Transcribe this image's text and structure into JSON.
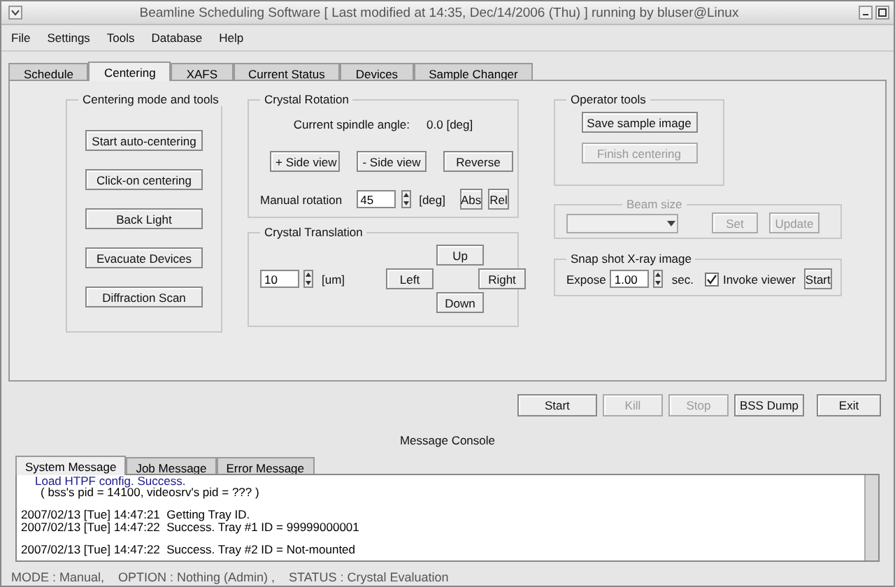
{
  "window": {
    "title": "Beamline Scheduling Software [ Last modified at 14:35, Dec/14/2006 (Thu) ] running by bluser@Linux"
  },
  "menu": [
    "File",
    "Settings",
    "Tools",
    "Database",
    "Help"
  ],
  "tabs": [
    {
      "label": "Schedule",
      "selected": false
    },
    {
      "label": "Centering",
      "selected": true
    },
    {
      "label": "XAFS",
      "selected": false
    },
    {
      "label": "Current Status",
      "selected": false
    },
    {
      "label": "Devices",
      "selected": false
    },
    {
      "label": "Sample Changer",
      "selected": false
    }
  ],
  "centering_tools": {
    "title": "Centering mode and tools",
    "buttons": [
      "Start auto-centering",
      "Click-on centering",
      "Back Light",
      "Evacuate Devices",
      "Diffraction Scan"
    ]
  },
  "crystal_rotation": {
    "title": "Crystal Rotation",
    "angle_label": "Current spindle angle:",
    "angle_value": "0.0 [deg]",
    "buttons": [
      "+ Side view",
      "- Side view",
      "Reverse"
    ],
    "manual_label": "Manual rotation",
    "manual_value": "45",
    "unit": "[deg]",
    "manual_buttons": [
      "Abs",
      "Rel"
    ]
  },
  "crystal_translation": {
    "title": "Crystal Translation",
    "step_value": "10",
    "unit": "[um]",
    "buttons": [
      {
        "label": "Up",
        "kind": "up"
      },
      {
        "label": "Left",
        "kind": "left"
      },
      {
        "label": "Right",
        "kind": "right"
      },
      {
        "label": "Down",
        "kind": "down"
      }
    ]
  },
  "operator_tools": {
    "title": "Operator tools",
    "buttons": [
      {
        "label": "Save sample image",
        "disabled": false
      },
      {
        "label": "Finish centering",
        "disabled": true
      }
    ]
  },
  "beam_size": {
    "title": "Beam size",
    "disabled": true,
    "buttons": [
      {
        "label": "Set",
        "disabled": true
      },
      {
        "label": "Update",
        "disabled": true
      }
    ]
  },
  "snapshot": {
    "title": "Snap shot X-ray image",
    "expose_label": "Expose",
    "expose_value": "1.00",
    "unit": "sec.",
    "invoke_viewer": {
      "label": "Invoke viewer",
      "checked": true
    },
    "button": "Start"
  },
  "actions": [
    {
      "label": "Start",
      "disabled": false
    },
    {
      "label": "Kill",
      "disabled": true
    },
    {
      "label": "Stop",
      "disabled": true
    },
    {
      "label": "BSS Dump",
      "disabled": false
    },
    {
      "label": "Exit",
      "disabled": false
    }
  ],
  "console": {
    "title": "Message Console",
    "tabs": [
      {
        "label": "System Message",
        "selected": true
      },
      {
        "label": "Job Message",
        "selected": false
      },
      {
        "label": "Error Message",
        "selected": false
      }
    ],
    "lines": [
      {
        "text": "Load HTPF config. Success.",
        "color": "#1a1a8c",
        "gap_before": false
      },
      {
        "text": "( bss's pid = 14100, videosrv's pid = ??? )",
        "color": "#000000",
        "gap_before": false
      },
      {
        "text": "2007/02/13 [Tue] 14:47:21  Getting Tray ID.",
        "color": "#000000",
        "gap_before": true
      },
      {
        "text": "2007/02/13 [Tue] 14:47:22  Success. Tray #1 ID = 99999000001",
        "color": "#000000",
        "gap_before": false
      },
      {
        "text": "2007/02/13 [Tue] 14:47:22  Success. Tray #2 ID = Not-mounted",
        "color": "#000000",
        "gap_before": true
      }
    ]
  },
  "status_bar": "MODE : Manual,    OPTION : Nothing (Admin) ,    STATUS : Crystal Evaluation"
}
